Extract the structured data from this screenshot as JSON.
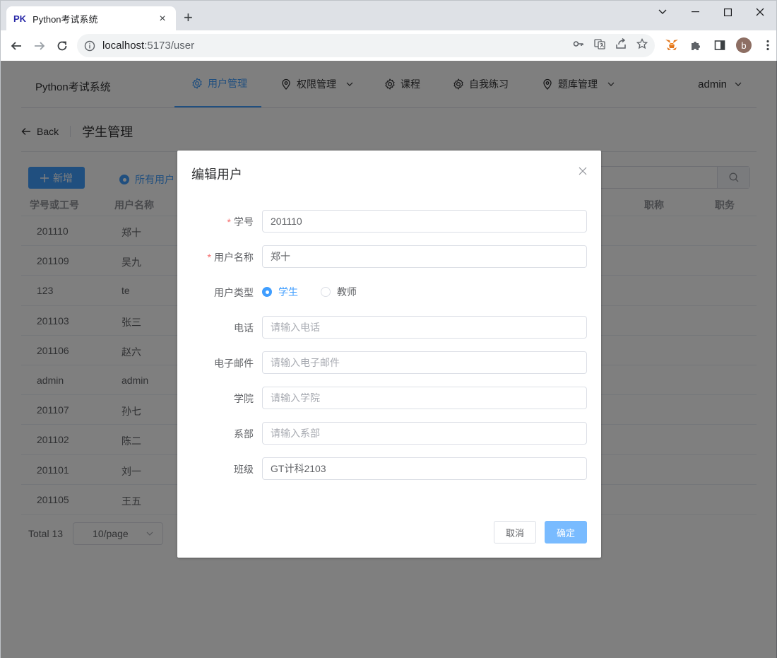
{
  "browser": {
    "tab_icon_text": "PK",
    "tab_title": "Python考试系统",
    "url_host": "localhost",
    "url_rest": ":5173/user"
  },
  "app": {
    "brand": "Python考试系统",
    "menu": [
      {
        "label": "用户管理"
      },
      {
        "label": "权限管理"
      },
      {
        "label": "课程"
      },
      {
        "label": "自我练习"
      },
      {
        "label": "题库管理"
      }
    ],
    "user": "admin"
  },
  "page_header": {
    "back_label": "Back",
    "title": "学生管理"
  },
  "toolbar": {
    "add_label": "新增",
    "filter_label": "所有用户"
  },
  "table": {
    "headers": [
      "学号或工号",
      "用户名称",
      "职称",
      "职务"
    ],
    "rows": [
      {
        "id": "201110",
        "name": "郑十"
      },
      {
        "id": "201109",
        "name": "吴九"
      },
      {
        "id": "123",
        "name": "te"
      },
      {
        "id": "201103",
        "name": "张三"
      },
      {
        "id": "201106",
        "name": "赵六"
      },
      {
        "id": "admin",
        "name": "admin"
      },
      {
        "id": "201107",
        "name": "孙七"
      },
      {
        "id": "201102",
        "name": "陈二"
      },
      {
        "id": "201101",
        "name": "刘一"
      },
      {
        "id": "201105",
        "name": "王五"
      }
    ]
  },
  "pagination": {
    "total_label": "Total 13",
    "page_size": "10/page"
  },
  "dialog": {
    "title": "编辑用户",
    "fields": {
      "student_id": {
        "label": "学号",
        "value": "201110",
        "required": true
      },
      "user_name": {
        "label": "用户名称",
        "value": "郑十",
        "required": true
      },
      "user_type": {
        "label": "用户类型",
        "options": [
          "学生",
          "教师"
        ],
        "selected": "学生"
      },
      "phone": {
        "label": "电话",
        "value": "",
        "placeholder": "请输入电话"
      },
      "email": {
        "label": "电子邮件",
        "value": "",
        "placeholder": "请输入电子邮件"
      },
      "college": {
        "label": "学院",
        "value": "",
        "placeholder": "请输入学院"
      },
      "department": {
        "label": "系部",
        "value": "",
        "placeholder": "请输入系部"
      },
      "class": {
        "label": "班级",
        "value": "GT计科2103",
        "placeholder": ""
      }
    },
    "cancel_label": "取消",
    "confirm_label": "确定"
  },
  "colors": {
    "primary": "#409eff",
    "primary_light": "#79bbff",
    "required": "#f56c6c",
    "overlay": "rgba(0,0,0,0.5)"
  }
}
